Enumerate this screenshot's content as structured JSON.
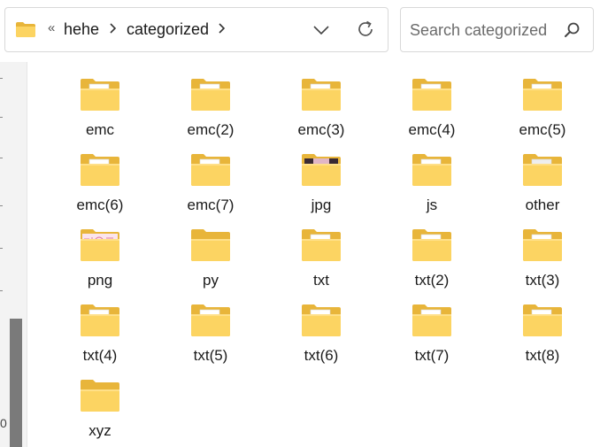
{
  "address_bar": {
    "overflow_glyph": "«",
    "breadcrumbs": [
      "hehe",
      "categorized"
    ]
  },
  "search": {
    "placeholder": "Search categorized"
  },
  "left_pane": {
    "partial_text": "0"
  },
  "folders": [
    {
      "name": "emc",
      "thumb": "doc"
    },
    {
      "name": "emc(2)",
      "thumb": "doc"
    },
    {
      "name": "emc(3)",
      "thumb": "doc"
    },
    {
      "name": "emc(4)",
      "thumb": "doc"
    },
    {
      "name": "emc(5)",
      "thumb": "doc"
    },
    {
      "name": "emc(6)",
      "thumb": "doc"
    },
    {
      "name": "emc(7)",
      "thumb": "doc"
    },
    {
      "name": "jpg",
      "thumb": "photo"
    },
    {
      "name": "js",
      "thumb": "doc-green"
    },
    {
      "name": "other",
      "thumb": "doc-gray"
    },
    {
      "name": "png",
      "thumb": "pink"
    },
    {
      "name": "py",
      "thumb": "empty"
    },
    {
      "name": "txt",
      "thumb": "doc"
    },
    {
      "name": "txt(2)",
      "thumb": "doc"
    },
    {
      "name": "txt(3)",
      "thumb": "doc"
    },
    {
      "name": "txt(4)",
      "thumb": "doc"
    },
    {
      "name": "txt(5)",
      "thumb": "doc"
    },
    {
      "name": "txt(6)",
      "thumb": "doc"
    },
    {
      "name": "txt(7)",
      "thumb": "doc"
    },
    {
      "name": "txt(8)",
      "thumb": "doc"
    },
    {
      "name": "xyz",
      "thumb": "empty"
    }
  ],
  "colors": {
    "folder_back": "#e8b53a",
    "folder_front": "#fcd462",
    "folder_front_light": "#ffe088",
    "accent": "#f5c238"
  }
}
